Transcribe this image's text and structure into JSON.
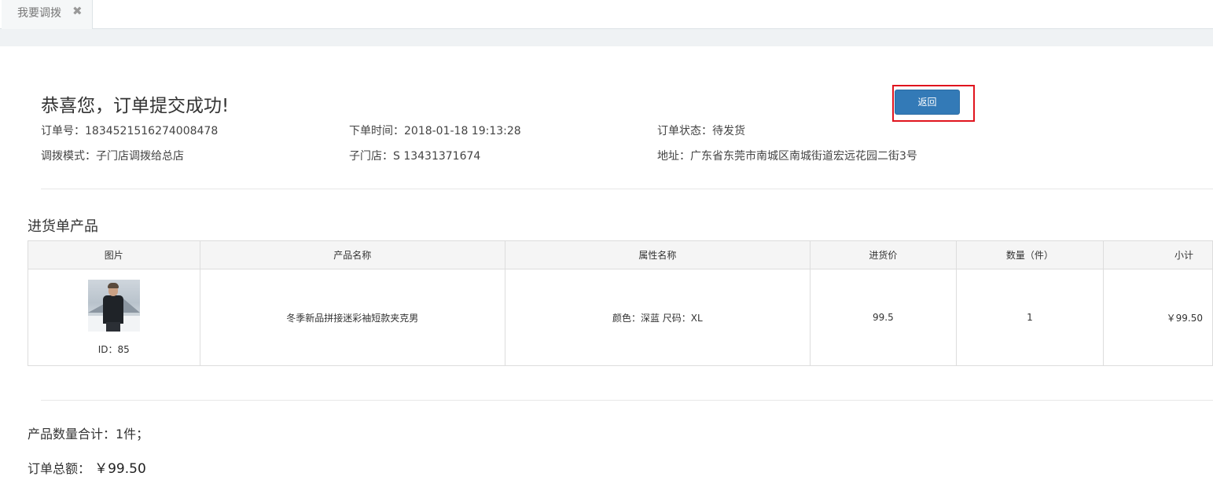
{
  "tabs": [
    {
      "label": "我要调拨",
      "close_icon": "close-icon"
    }
  ],
  "header": {
    "title": "恭喜您，订单提交成功!",
    "back_button": "返回"
  },
  "order_info": {
    "order_no": "订单号：1834521516274008478",
    "order_time": "下单时间：2018-01-18 19:13:28",
    "order_status": "订单状态：待发货",
    "transfer_mode": "调拨模式：子门店调拨给总店",
    "sub_store": "子门店：S  13431371674",
    "address": "地址：广东省东莞市南城区南城街道宏远花园二街3号"
  },
  "products_section": {
    "title": "进货单产品",
    "columns": [
      "图片",
      "产品名称",
      "属性名称",
      "进货价",
      "数量（件）",
      "小计"
    ],
    "rows": [
      {
        "image_icon": "product-photo",
        "id_label": "ID：85",
        "name": "冬季新品拼接迷彩袖短款夹克男",
        "attributes": "颜色：深蓝 尺码：XL",
        "price": "99.5",
        "quantity": "1",
        "subtotal": "￥99.50"
      }
    ]
  },
  "summary": {
    "total_quantity": "产品数量合计：1件；",
    "total_amount_label": "订单总额：",
    "total_amount_value": "￥99.50"
  },
  "colors": {
    "primary_button": "#337ab7",
    "highlight_border": "#e0141e",
    "tab_background": "#f5f7f8",
    "band_background": "#eff2f4",
    "table_header_background": "#f5f5f5"
  }
}
